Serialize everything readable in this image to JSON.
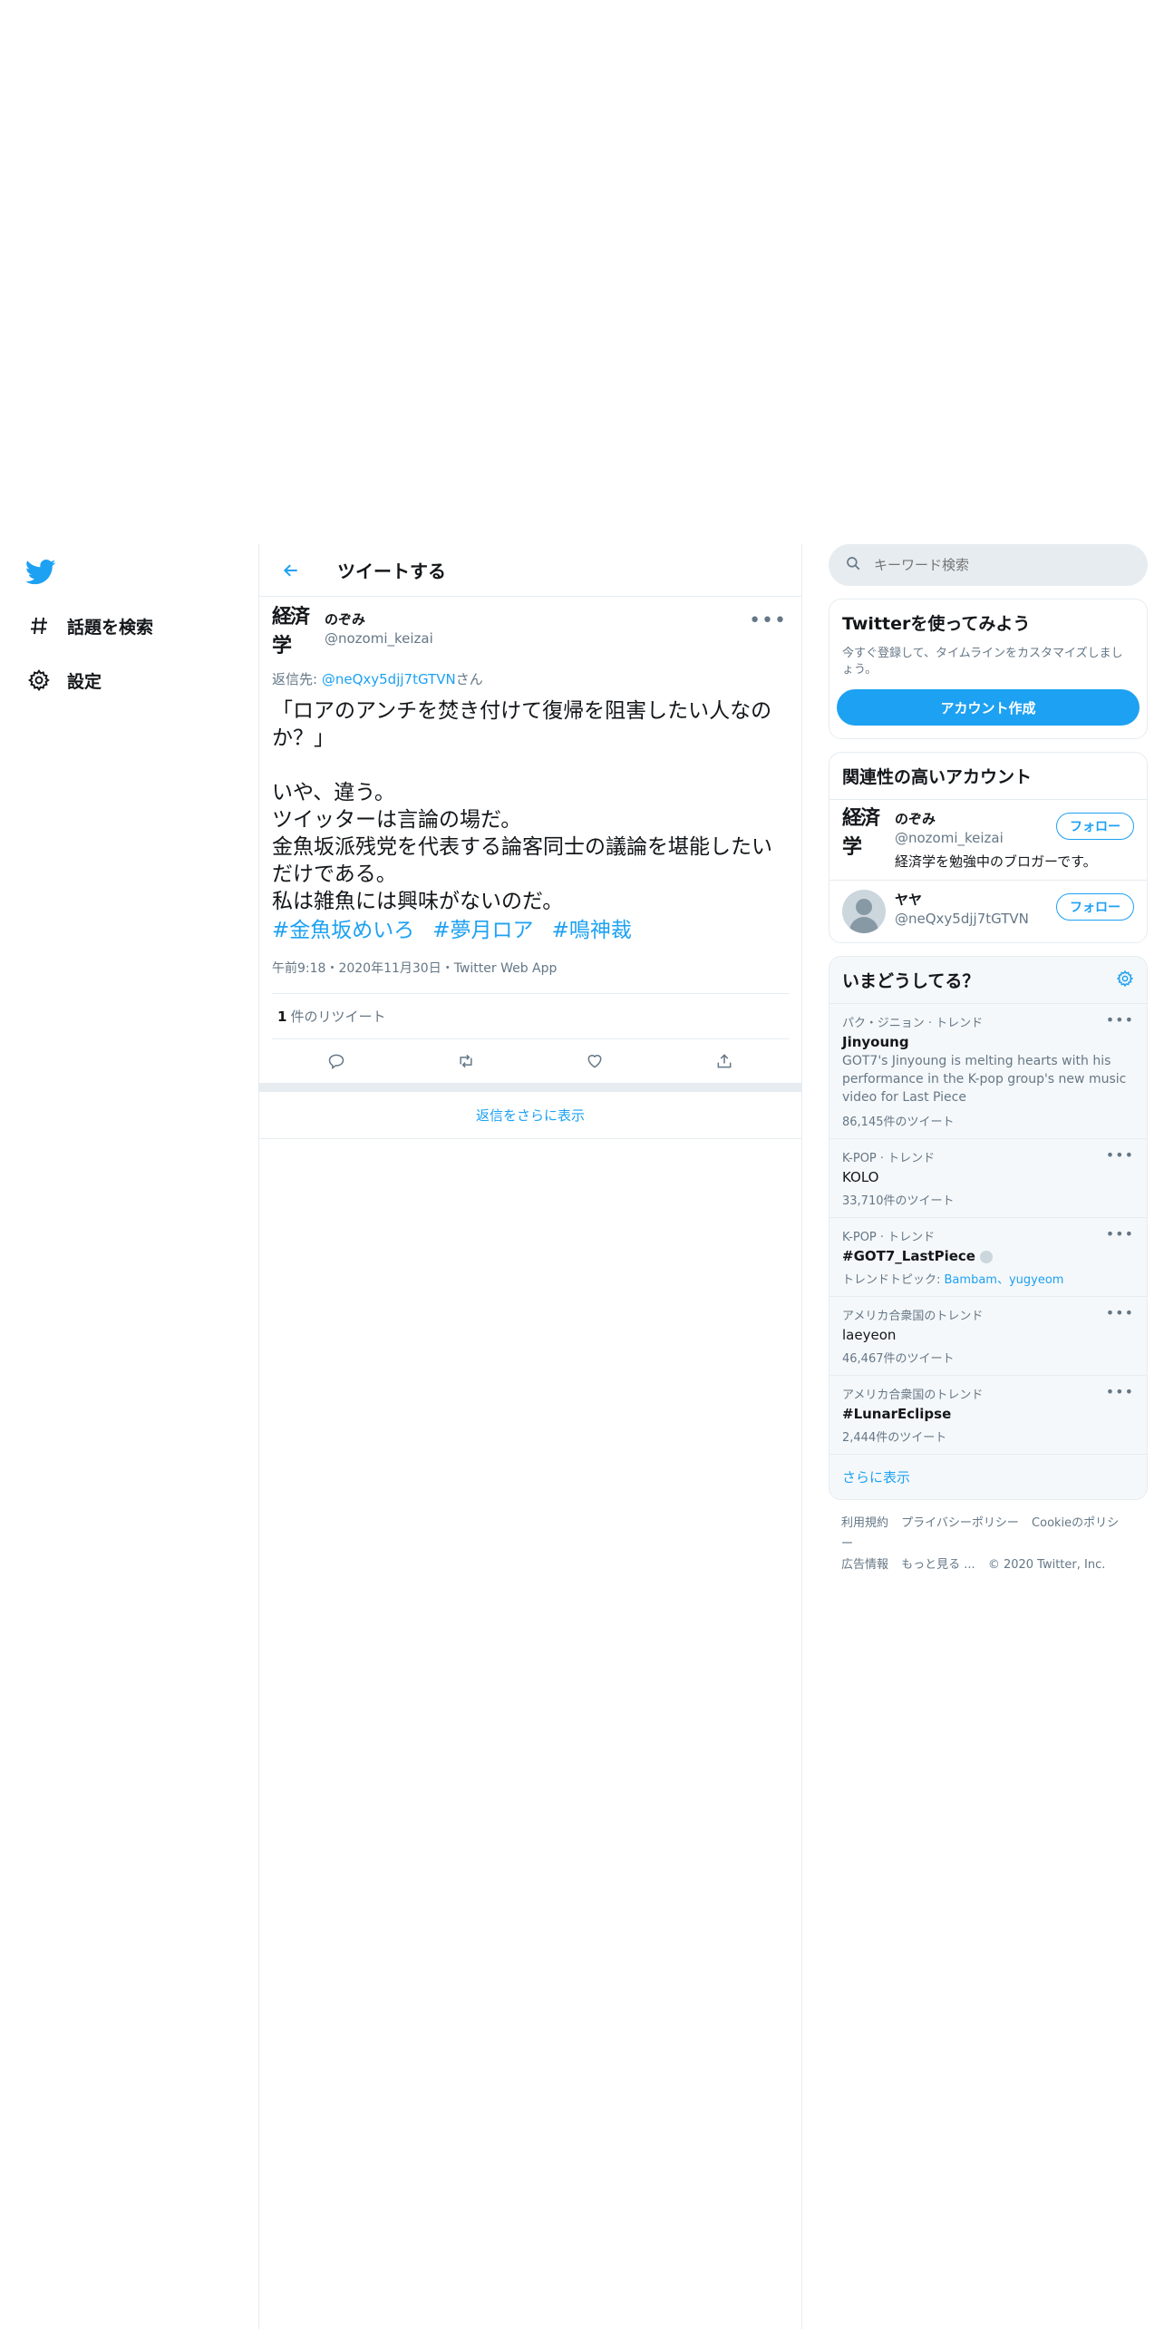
{
  "nav": {
    "items": [
      {
        "label": "話題を検索",
        "icon": "hashtag-icon"
      },
      {
        "label": "設定",
        "icon": "gear-icon"
      }
    ]
  },
  "header": {
    "title": "ツイートする"
  },
  "tweet": {
    "avatar_text": "経済学",
    "name": "のぞみ",
    "handle": "@nozomi_keizai",
    "reply_prefix": "返信先: ",
    "reply_handle": "@neQxy5djj7tGTVN",
    "reply_suffix": "さん",
    "body": "「ロアのアンチを焚き付けて復帰を阻害したい人なのか？」\n\nいや、違う。\nツイッターは言論の場だ。\n金魚坂派残党を代表する論客同士の議論を堪能したいだけである。\n私は雑魚には興味がないのだ。",
    "hashtags": [
      "#金魚坂めいろ",
      "#夢月ロア",
      "#鳴神裁"
    ],
    "meta": "午前9:18・2020年11月30日・Twitter Web App",
    "retweet_count": "1",
    "retweet_label": "件のリツイート"
  },
  "more_replies": "返信をさらに表示",
  "search": {
    "placeholder": "キーワード検索"
  },
  "signup": {
    "title": "Twitterを使ってみよう",
    "desc": "今すぐ登録して、タイムラインをカスタマイズしましょう。",
    "button": "アカウント作成"
  },
  "related": {
    "title": "関連性の高いアカウント",
    "accounts": [
      {
        "name": "のぞみ",
        "handle": "@nozomi_keizai",
        "bio": "経済学を勉強中のブロガーです。",
        "follow": "フォロー",
        "avatar_text": "経済学"
      },
      {
        "name": "ヤヤ",
        "handle": "@neQxy5djj7tGTVN",
        "bio": "",
        "follow": "フォロー"
      }
    ]
  },
  "trends": {
    "title": "いまどうしてる？",
    "items": [
      {
        "context": "パク・ジニョン · トレンド",
        "name": "Jinyoung",
        "desc": "GOT7's Jinyoung is melting hearts with his performance in the K-pop group's new music video for Last Piece",
        "count": "86,145件のツイート"
      },
      {
        "context": "K-POP · トレンド",
        "name": "KOLO",
        "count": "33,710件のツイート"
      },
      {
        "context": "K-POP · トレンド",
        "name": "#GOT7_LastPiece",
        "topics_label": "トレンドトピック: ",
        "topics": "Bambam、yugyeom"
      },
      {
        "context": "アメリカ合衆国のトレンド",
        "name": "laeyeon",
        "count": "46,467件のツイート"
      },
      {
        "context": "アメリカ合衆国のトレンド",
        "name": "#LunarEclipse",
        "count": "2,444件のツイート"
      }
    ],
    "show_more": "さらに表示"
  },
  "footer": {
    "links": [
      "利用規約",
      "プライバシーポリシー",
      "Cookieのポリシー",
      "広告情報",
      "もっと見る ..."
    ],
    "copyright": "© 2020 Twitter, Inc."
  },
  "colors": {
    "accent": "#1da1f2",
    "border": "#e6ecf0",
    "muted": "#657786"
  }
}
